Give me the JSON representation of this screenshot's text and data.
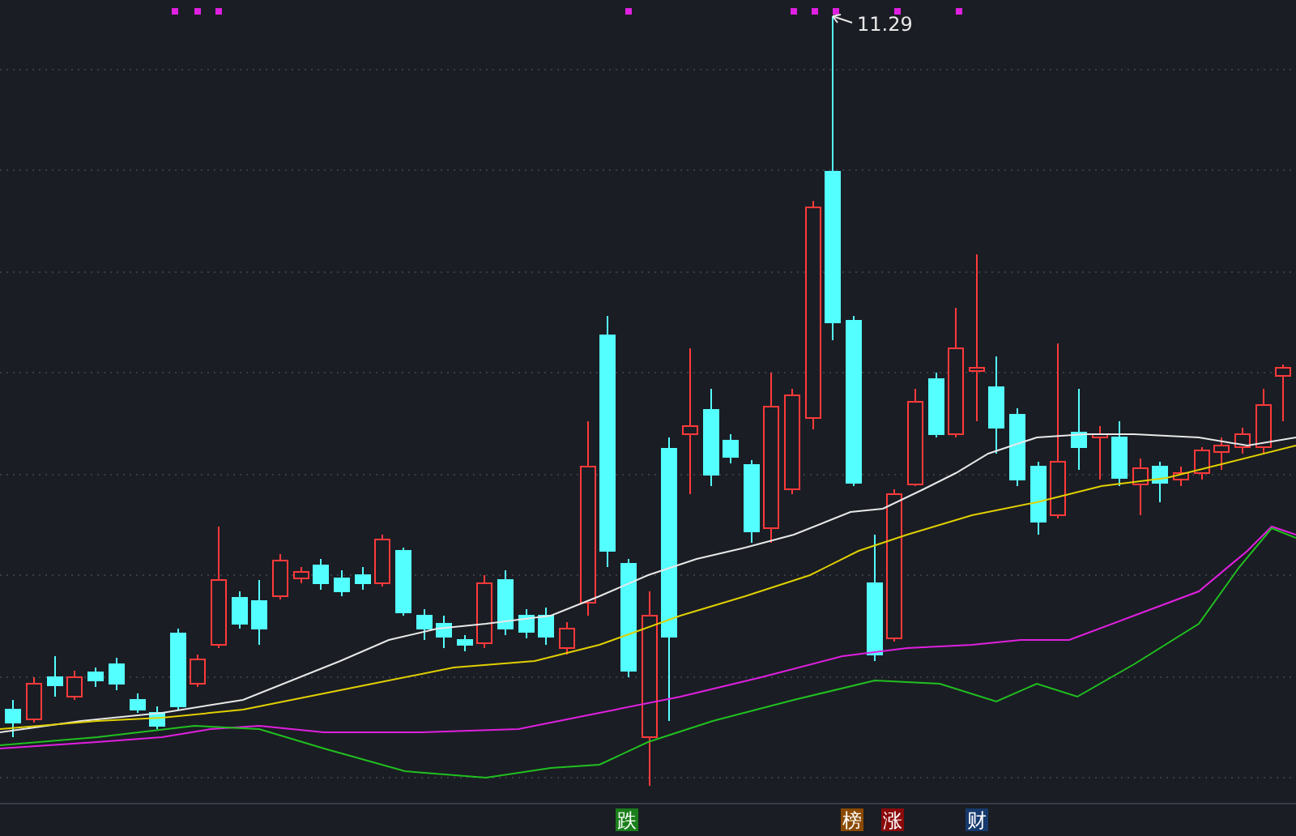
{
  "chart": {
    "high_label": "11.29"
  },
  "markers": [
    {
      "label": "跌",
      "color": "#1a7f1a"
    },
    {
      "label": "榜",
      "color": "#8b4a00"
    },
    {
      "label": "涨",
      "color": "#8b0a0a"
    },
    {
      "label": "财",
      "color": "#163a6e"
    }
  ]
}
